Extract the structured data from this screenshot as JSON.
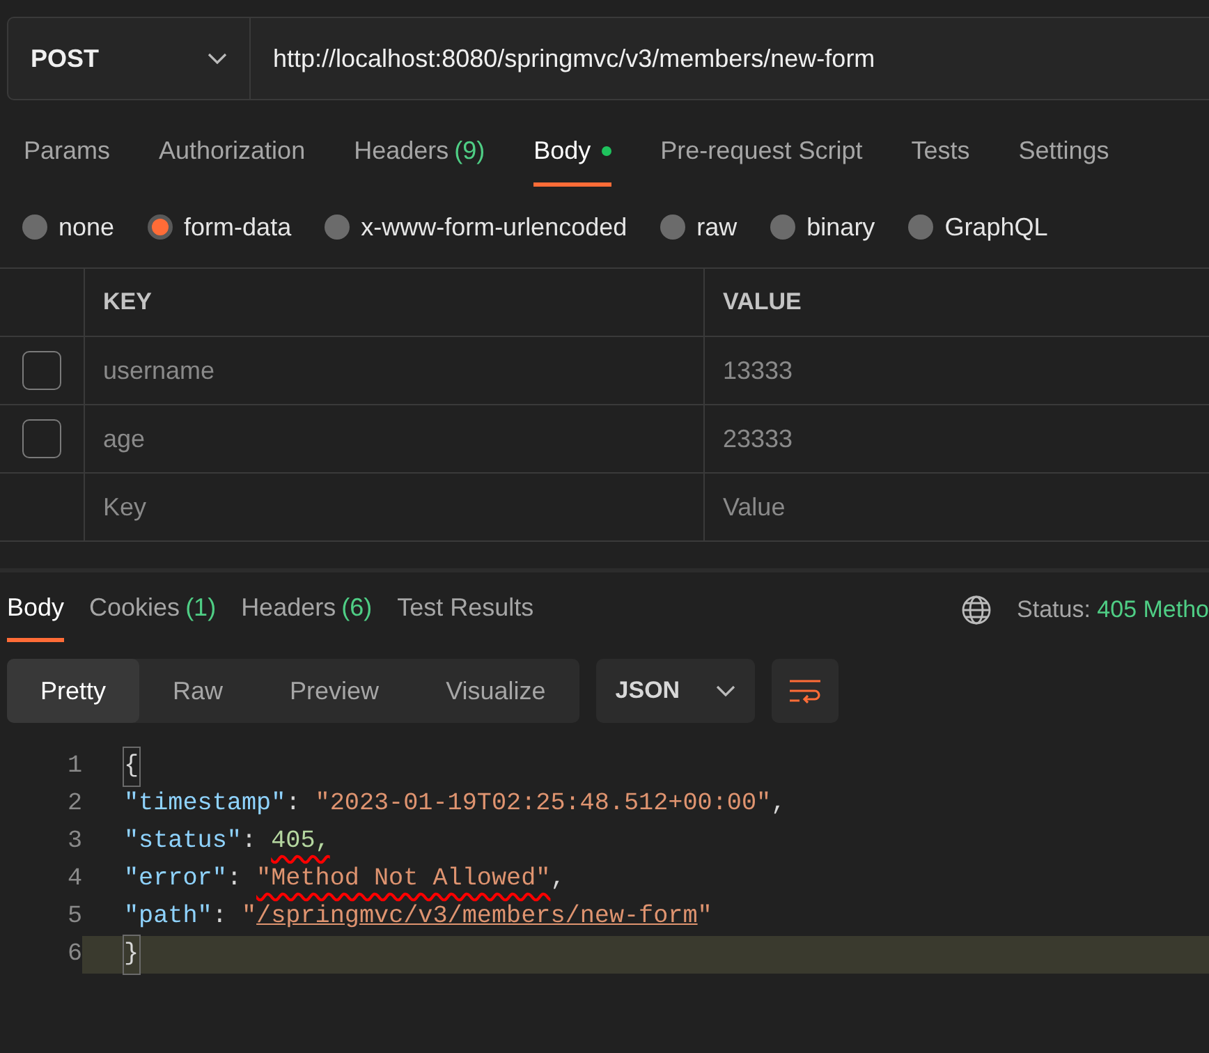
{
  "request": {
    "method": "POST",
    "url": "http://localhost:8080/springmvc/v3/members/new-form"
  },
  "request_tabs": [
    {
      "label": "Params",
      "selected": false
    },
    {
      "label": "Authorization",
      "selected": false
    },
    {
      "label": "Headers",
      "count": "(9)",
      "selected": false
    },
    {
      "label": "Body",
      "selected": true,
      "dot": true
    },
    {
      "label": "Pre-request Script",
      "selected": false
    },
    {
      "label": "Tests",
      "selected": false
    },
    {
      "label": "Settings",
      "selected": false
    }
  ],
  "body_types": [
    {
      "label": "none",
      "selected": false
    },
    {
      "label": "form-data",
      "selected": true
    },
    {
      "label": "x-www-form-urlencoded",
      "selected": false
    },
    {
      "label": "raw",
      "selected": false
    },
    {
      "label": "binary",
      "selected": false
    },
    {
      "label": "GraphQL",
      "selected": false
    }
  ],
  "params_table": {
    "columns": [
      "KEY",
      "VALUE"
    ],
    "rows": [
      {
        "checked": false,
        "key": "username",
        "value": "13333"
      },
      {
        "checked": false,
        "key": "age",
        "value": "23333"
      }
    ],
    "new_row": {
      "key_placeholder": "Key",
      "value_placeholder": "Value"
    }
  },
  "response_tabs": [
    {
      "label": "Body",
      "selected": true
    },
    {
      "label": "Cookies",
      "count": "(1)",
      "selected": false
    },
    {
      "label": "Headers",
      "count": "(6)",
      "selected": false
    },
    {
      "label": "Test Results",
      "selected": false
    }
  ],
  "status": {
    "label": "Status:",
    "value": "405 Metho"
  },
  "view_modes": [
    {
      "label": "Pretty",
      "selected": true
    },
    {
      "label": "Raw",
      "selected": false
    },
    {
      "label": "Preview",
      "selected": false
    },
    {
      "label": "Visualize",
      "selected": false
    }
  ],
  "format": "JSON",
  "code_lines": [
    {
      "number": "1",
      "current": false,
      "tokens": [
        {
          "kind": "brace",
          "text": "{"
        }
      ]
    },
    {
      "number": "2",
      "current": false,
      "tokens": [
        {
          "kind": "key",
          "text": "\"timestamp\""
        },
        {
          "kind": "punct",
          "text": ": "
        },
        {
          "kind": "string",
          "text": "\"2023-01-19T02:25:48.512+00:00\""
        },
        {
          "kind": "punct",
          "text": ","
        }
      ]
    },
    {
      "number": "3",
      "current": false,
      "tokens": [
        {
          "kind": "key",
          "text": "\"status\""
        },
        {
          "kind": "punct",
          "text": ": "
        },
        {
          "kind": "number",
          "text": "405,",
          "underlined": true
        }
      ]
    },
    {
      "number": "4",
      "current": false,
      "tokens": [
        {
          "kind": "key",
          "text": "\"error\""
        },
        {
          "kind": "punct",
          "text": ": "
        },
        {
          "kind": "string",
          "text": "\"Method Not Allowed\"",
          "underlined": true
        },
        {
          "kind": "punct",
          "text": ","
        }
      ]
    },
    {
      "number": "5",
      "current": false,
      "tokens": [
        {
          "kind": "key",
          "text": "\"path\""
        },
        {
          "kind": "punct",
          "text": ": "
        },
        {
          "kind": "string",
          "text": "\""
        },
        {
          "kind": "link",
          "text": "/springmvc/v3/members/new-form"
        },
        {
          "kind": "string",
          "text": "\""
        }
      ]
    },
    {
      "number": "6",
      "current": true,
      "tokens": [
        {
          "kind": "brace",
          "text": "}"
        }
      ]
    }
  ]
}
